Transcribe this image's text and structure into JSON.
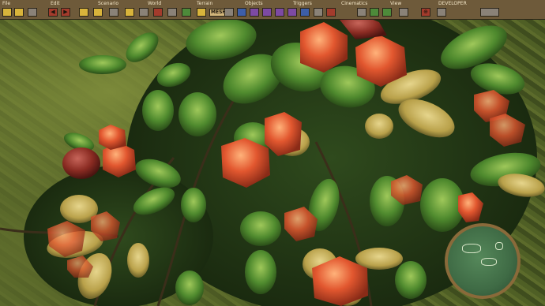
{
  "menus": [
    {
      "label": "File",
      "key": "file"
    },
    {
      "label": "Edit",
      "key": "edit"
    },
    {
      "label": "Scenario",
      "key": "scenario"
    },
    {
      "label": "World",
      "key": "world"
    },
    {
      "label": "Terrain",
      "key": "terrain"
    },
    {
      "label": "Objects",
      "key": "objects"
    },
    {
      "label": "Triggers",
      "key": "triggers"
    },
    {
      "label": "Cinematics",
      "key": "cinematics"
    },
    {
      "label": "View",
      "key": "view"
    },
    {
      "label": "DEVELOPER",
      "key": "developer"
    }
  ],
  "toolbar": {
    "mesh_label": "MESH",
    "icons": [
      "new-file-icon",
      "open-file-icon",
      "save-icon",
      "undo-icon",
      "redo-icon",
      "scenario-settings-icon",
      "player-settings-icon",
      "diplomacy-icon",
      "world-lighting-icon",
      "water-icon",
      "paint-icon",
      "cliff-icon",
      "forest-icon",
      "terrain-paint-icon",
      "terrain-height-icon",
      "objects-icon",
      "units-icon",
      "buildings-icon",
      "resources-icon",
      "embellishment-icon",
      "cliff-objects-icon",
      "trigger-icon",
      "camera-track-icon",
      "cinematic-icon",
      "view-grid-icon",
      "view-toggle-icon",
      "view-camera-icon",
      "developer-target-icon",
      "developer-grid-icon",
      "developer-tool-icon"
    ]
  },
  "colors": {
    "menubar_bg": "#6e5a3a",
    "menu_text": "#f4e7c8",
    "foliage": "#3f6a24",
    "fruit_orange": "#e2572f",
    "fruit_red": "#8a2b22",
    "minimap_green": "#3f6b45"
  }
}
